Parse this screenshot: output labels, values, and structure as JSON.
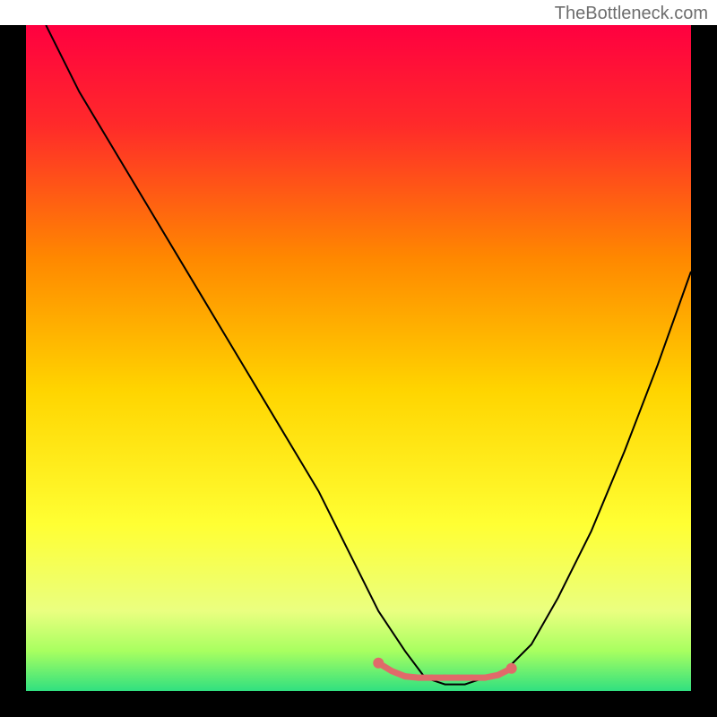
{
  "watermark": "TheBottleneck.com",
  "chart_data": {
    "type": "line",
    "title": "",
    "xlabel": "",
    "ylabel": "",
    "xlim": [
      0,
      100
    ],
    "ylim": [
      0,
      100
    ],
    "background_gradient": {
      "type": "vertical",
      "stops": [
        {
          "offset": 0,
          "color": "#ff0040"
        },
        {
          "offset": 15,
          "color": "#ff2a2a"
        },
        {
          "offset": 35,
          "color": "#ff8800"
        },
        {
          "offset": 55,
          "color": "#ffd500"
        },
        {
          "offset": 75,
          "color": "#ffff33"
        },
        {
          "offset": 88,
          "color": "#eaff80"
        },
        {
          "offset": 94,
          "color": "#a8ff60"
        },
        {
          "offset": 100,
          "color": "#30e080"
        }
      ]
    },
    "series": [
      {
        "name": "bottleneck-curve",
        "x": [
          3,
          8,
          14,
          20,
          26,
          32,
          38,
          44,
          49,
          53,
          57,
          60,
          63,
          66,
          69,
          72,
          76,
          80,
          85,
          90,
          95,
          100
        ],
        "y": [
          100,
          90,
          80,
          70,
          60,
          50,
          40,
          30,
          20,
          12,
          6,
          2,
          1,
          1,
          2,
          3,
          7,
          14,
          24,
          36,
          49,
          63
        ]
      }
    ],
    "highlight_region": {
      "name": "optimal-range",
      "x_start": 53,
      "x_end": 74,
      "color": "#e06a6a",
      "points_x": [
        53,
        55,
        57,
        59,
        61,
        63,
        65,
        67,
        69,
        71,
        73
      ],
      "points_y": [
        4.2,
        3.0,
        2.2,
        2.0,
        2.0,
        2.0,
        2.0,
        2.0,
        2.0,
        2.4,
        3.4
      ]
    }
  }
}
